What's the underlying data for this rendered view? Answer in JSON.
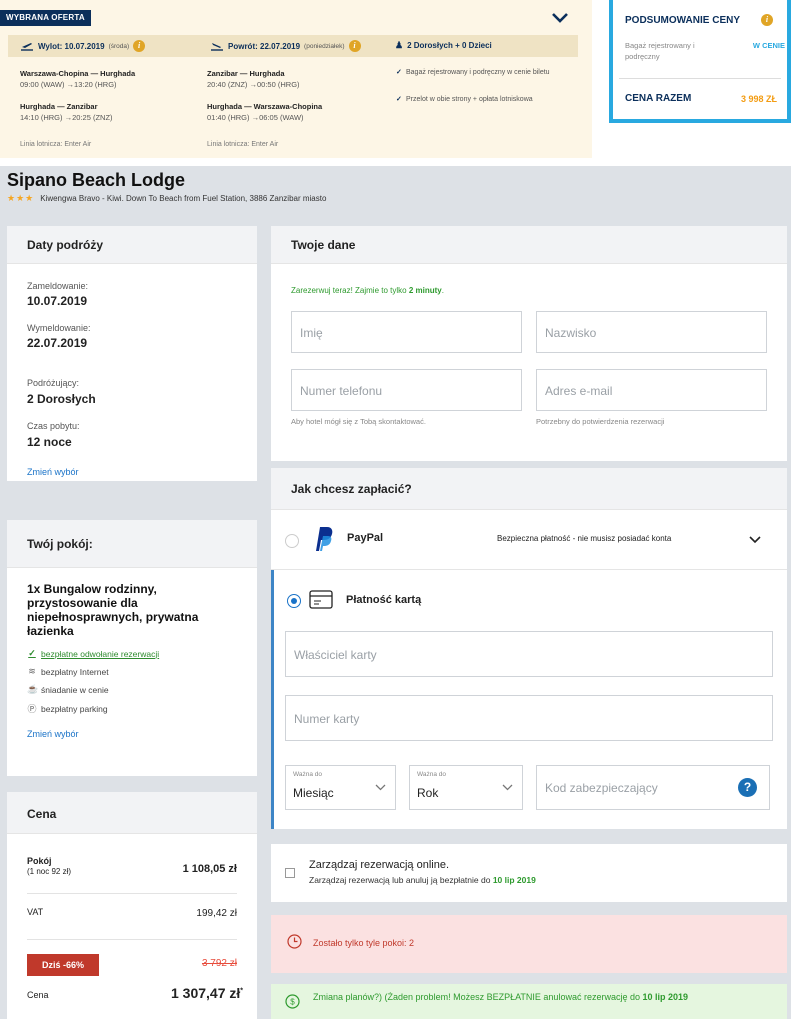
{
  "offer": {
    "tag": "WYBRANA OFERTA",
    "outbound": {
      "label": "Wylot: 10.07.2019",
      "day": "(środa)"
    },
    "inbound": {
      "label": "Powrót: 22.07.2019",
      "day": "(poniedziałek)"
    },
    "passengers": "2 Dorosłych + 0 Dzieci",
    "segments": [
      {
        "route": "Warszawa-Chopina — Hurghada",
        "times": "09:00 (WAW) →13:20 (HRG)"
      },
      {
        "route": "Hurghada — Zanzibar",
        "times": "14:10 (HRG) →20:25 (ZNZ)"
      },
      {
        "route": "Zanzibar — Hurghada",
        "times": "20:40 (ZNZ) →00:50 (HRG)"
      },
      {
        "route": "Hurghada — Warszawa-Chopina",
        "times": "01:40 (HRG) →06:05 (WAW)"
      }
    ],
    "airline_out": "Linia lotnicza: Enter Air",
    "airline_in": "Linia lotnicza: Enter Air",
    "features": [
      "Bagaż rejestrowany i podręczny w cenie biletu",
      "Przelot w obie strony + opłata lotniskowa"
    ]
  },
  "summary": {
    "title": "PODSUMOWANIE CENY",
    "baggage_label": "Bagaż rejestrowany i podręczny",
    "baggage_value": "W CENIE",
    "total_label": "CENA RAZEM",
    "total_value": "3 998 ZŁ"
  },
  "hotel": {
    "name": "Sipano Beach Lodge",
    "stars": "★★★",
    "address": "Kiwengwa Bravo - Kiwi. Down To Beach from Fuel Station, 3886 Zanzibar miasto"
  },
  "dates": {
    "title": "Daty podróży",
    "checkin_label": "Zameldowanie:",
    "checkin": "10.07.2019",
    "checkout_label": "Wymeldowanie:",
    "checkout": "22.07.2019",
    "travelers_label": "Podróżujący:",
    "travelers": "2 Dorosłych",
    "stay_label": "Czas pobytu:",
    "stay": "12 noce",
    "change": "Zmień wybór"
  },
  "room": {
    "title": "Twój pokój:",
    "name": "1x Bungalow rodzinny, przystosowanie dla niepełnosprawnych, prywatna łazienka",
    "amenities": [
      "bezpłatne odwołanie rezerwacji",
      "bezpłatny Internet",
      "śniadanie w cenie",
      "bezpłatny parking"
    ],
    "change": "Zmień wybór"
  },
  "price": {
    "title": "Cena",
    "room_label": "Pokój",
    "room_sub": "(1 noc 92 zł)",
    "room_value": "1 108,05 zł",
    "vat_label": "VAT",
    "vat_value": "199,42 zł",
    "discount": "Dziś -66%",
    "old_price": "3 792 zł",
    "final_label": "Cena",
    "final_value": "1 307,47 zł",
    "asterisk": "*"
  },
  "form": {
    "title": "Twoje dane",
    "promo_text": "Zarezerwuj teraz! Zajmie to tylko ",
    "promo_bold": "2 minuty",
    "promo_end": ".",
    "first_name": "Imię",
    "last_name": "Nazwisko",
    "phone": "Numer telefonu",
    "email": "Adres e-mail",
    "phone_hint": "Aby hotel mógł się z Tobą skontaktować.",
    "email_hint": "Potrzebny do potwierdzenia rezerwacji"
  },
  "payment": {
    "title": "Jak chcesz zapłacić?",
    "paypal_label": "PayPal",
    "paypal_note": "Bezpieczna płatność - nie musisz posiadać konta",
    "card_label": "Płatność kartą",
    "card_owner": "Właściciel karty",
    "card_number": "Numer karty",
    "valid_label_1": "Ważna do",
    "month": "Miesiąc",
    "valid_label_2": "Ważna do",
    "year": "Rok",
    "cvc": "Kod zabezpieczający",
    "help": "?"
  },
  "manage": {
    "title": "Zarządzaj rezerwacją online.",
    "text": "Zarządzaj rezerwacją lub anuluj ją bezpłatnie do ",
    "date": "10 lip 2019"
  },
  "rooms_left": "Zostało tylko tyle pokoi: 2",
  "cancel": {
    "text": "Zmiana planów?) (Żaden problem! Możesz BEZPŁATNIE anulować rezerwację do ",
    "date": "10 lip 2019"
  },
  "colors": {
    "navy": "#0b2f5b",
    "accent": "#29a9e0",
    "orange": "#f39c12",
    "green": "#2e9a2e",
    "red": "#c0392b"
  }
}
